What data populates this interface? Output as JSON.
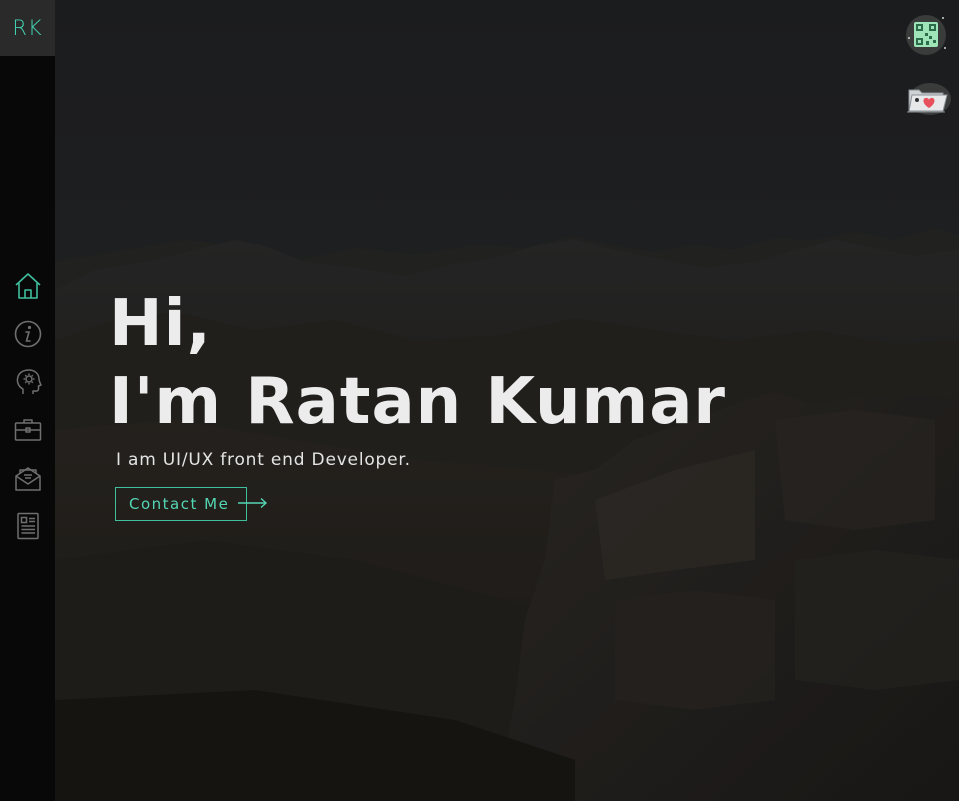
{
  "brand": {
    "logo_text": "RK",
    "accent": "#43d3b0"
  },
  "sidebar": {
    "items": [
      {
        "id": "home",
        "icon": "home-icon",
        "active": true
      },
      {
        "id": "about",
        "icon": "info-icon",
        "active": false
      },
      {
        "id": "skills",
        "icon": "head-gear-icon",
        "active": false
      },
      {
        "id": "work",
        "icon": "briefcase-icon",
        "active": false
      },
      {
        "id": "contact",
        "icon": "mail-stack-icon",
        "active": false
      },
      {
        "id": "resume",
        "icon": "document-icon",
        "active": false
      }
    ]
  },
  "hero": {
    "greeting": "Hi,",
    "name_line": "I'm Ratan Kumar",
    "subtitle": "I am UI/UX front end Developer.",
    "cta_label": "Contact Me"
  },
  "floating": {
    "qr_icon": "qr-code-icon",
    "folder_icon": "folder-heart-icon"
  }
}
